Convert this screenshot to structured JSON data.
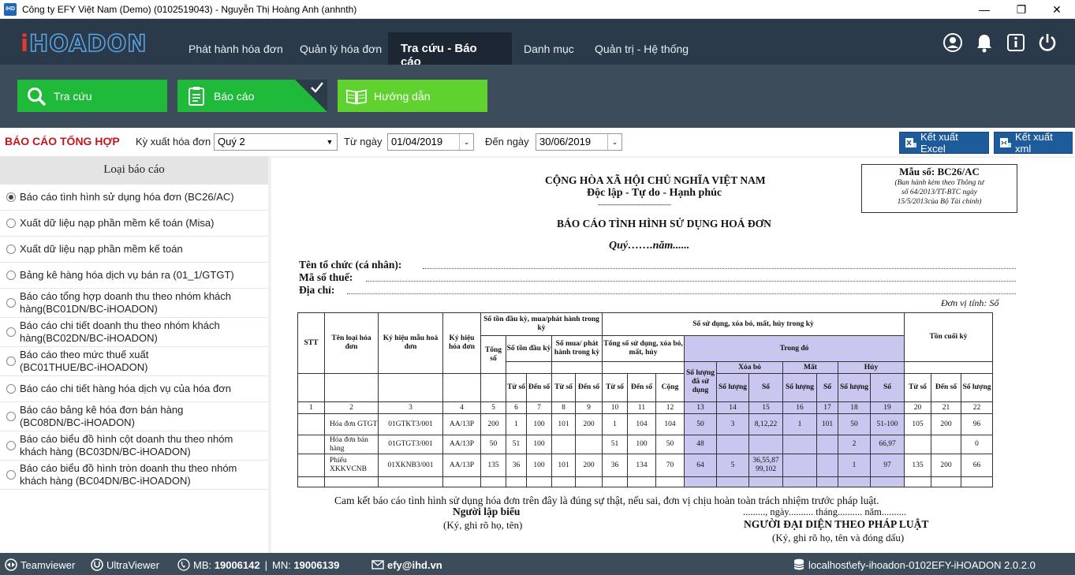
{
  "window": {
    "app_icon_text": "iHD",
    "title": "Công ty EFY Việt Nam (Demo) (0102519043) - Nguyễn Thị Hoàng Anh (anhnth)",
    "minimize": "—",
    "maximize": "❐",
    "close": "✕"
  },
  "brand": {
    "logo_i": "i",
    "logo_rest": "HOADON"
  },
  "nav": {
    "items": [
      "Phát hành hóa đơn",
      "Quản lý hóa đơn",
      "Tra cứu -  Báo cáo",
      "Danh mục",
      "Quản trị - Hệ thống"
    ],
    "active_index": 2,
    "icons": [
      "user-icon",
      "bell-icon",
      "info-icon",
      "power-icon"
    ]
  },
  "subnav": {
    "buttons": [
      {
        "label": "Tra cứu",
        "icon": "search-icon",
        "color": "#1fba3a"
      },
      {
        "label": "Báo cáo",
        "icon": "clipboard-icon",
        "color": "#1fba3a",
        "checked": true
      },
      {
        "label": "Hướng dẫn",
        "icon": "book-icon",
        "color": "#5fd22f"
      }
    ]
  },
  "filters": {
    "report_heading": "BÁO CÁO TỔNG HỢP",
    "period_label": "Kỳ xuất hóa đơn",
    "period_value": "Quý 2",
    "from_label": "Từ ngày",
    "from_value": "01/04/2019",
    "to_label": "Đến ngày",
    "to_value": "30/06/2019",
    "export_excel": "Kết xuất Excel",
    "export_xml": "Kết xuất xml"
  },
  "report_types": {
    "header": "Loại báo cáo",
    "selected_index": 0,
    "items": [
      {
        "line1": "Báo cáo tình hình sử dụng hóa đơn (BC26/AC)"
      },
      {
        "line1": "Xuất dữ liệu nạp phần mềm kế toán (Misa)"
      },
      {
        "line1": "Xuất dữ liệu nạp phần mềm kế toán"
      },
      {
        "line1": "Bảng kê hàng hóa dịch vụ bán ra (01_1/GTGT)"
      },
      {
        "line1": "Báo cáo tổng hợp doanh thu theo nhóm khách",
        "line2": "hàng(BC01DN/BC-iHOADON)"
      },
      {
        "line1": "Báo cáo chi tiết doanh thu theo nhóm khách",
        "line2": "hàng(BC02DN/BC-iHOADON)"
      },
      {
        "line1": "Báo cáo theo mức thuế xuất",
        "line2": "(BC01THUE/BC-iHOADON)"
      },
      {
        "line1": "Báo cáo chi tiết hàng hóa dịch vụ của hóa đơn"
      },
      {
        "line1": "Báo cáo bảng kê hóa đơn bán hàng",
        "line2": "(BC08DN/BC-iHOADON)"
      },
      {
        "line1": "Báo cáo biểu đồ hình cột doanh thu theo nhóm",
        "line2": "khách hàng (BC03DN/BC-iHOADON)"
      },
      {
        "line1": "Báo cáo biểu đồ hình tròn doanh thu theo nhóm",
        "line2": "khách hàng (BC04DN/BC-iHOADON)"
      }
    ]
  },
  "report": {
    "form_no": "Mẫu số: BC26/AC",
    "form_note1": "(Ban hành kèm theo Thông tư",
    "form_note2": "số 64/2013/TT-BTC  ngày",
    "form_note3": "15/5/2013của Bộ Tài chính)",
    "nation": "CỘNG HÒA XÃ HỘI CHỦ NGHĨA VIỆT NAM",
    "motto": "Độc lập - Tự do - Hạnh phúc",
    "motto_line": "-------------------------------",
    "title": "BÁO CÁO TÌNH HÌNH SỬ DỤNG HOÁ ĐƠN",
    "period": "Quý…….năm......",
    "org_label": "Tên tổ chức (cá nhân):",
    "tax_label": "Mã số thuế:",
    "addr_label": "Địa chỉ:",
    "unit": "Đơn vị tính: Số",
    "head": {
      "stt": "STT",
      "name": "Tên loại hóa đơn",
      "symbol": "Ký hiệu mẫu hoá đơn",
      "serial": "Ký hiệu hóa đơn",
      "opening_group": "Số tồn đầu kỳ, mua/phát hành trong kỳ",
      "total": "Tổng số",
      "opening": "Số tồn đầu kỳ",
      "bought": "Số mua/ phát hành trong kỳ",
      "used_group": "Số sử dụng, xóa bỏ, mất, hủy trong kỳ",
      "used_total": "Tổng số sử dụng, xóa bỏ, mất, hủy",
      "detail": "Trong đó",
      "used_qty": "Số lượng đã sử dụng",
      "deleted": "Xóa bỏ",
      "lost": "Mất",
      "cancelled": "Hủy",
      "closing": "Tồn cuối kỳ",
      "from_no": "Từ số",
      "to_no": "Đến số",
      "sum": "Cộng",
      "qty": "Số lượng",
      "num": "Số"
    },
    "col_numbers": [
      "1",
      "2",
      "3",
      "4",
      "5",
      "6",
      "7",
      "8",
      "9",
      "10",
      "11",
      "12",
      "13",
      "14",
      "15",
      "16",
      "17",
      "18",
      "19",
      "20",
      "21",
      "22"
    ],
    "rows": [
      [
        "",
        "Hóa đơn GTGT",
        "01GTKT3/001",
        "AA/13P",
        "200",
        "1",
        "100",
        "101",
        "200",
        "1",
        "104",
        "104",
        "50",
        "3",
        "8,12,22",
        "1",
        "101",
        "50",
        "51-100",
        "105",
        "200",
        "96"
      ],
      [
        "",
        "Hóa đơn bán hàng",
        "01GTGT3/001",
        "AA/13P",
        "50",
        "51",
        "100",
        "",
        "",
        "51",
        "100",
        "50",
        "48",
        "",
        "",
        "",
        "",
        "2",
        "66,97",
        "",
        "",
        "0"
      ],
      [
        "",
        "Phiếu XKKVCNB",
        "01XKNB3/001",
        "AA/13P",
        "135",
        "36",
        "100",
        "101",
        "200",
        "36",
        "134",
        "70",
        "64",
        "5",
        "36,55,87 99,102",
        "",
        "",
        "1",
        "97",
        "135",
        "200",
        "66"
      ],
      [
        "",
        "",
        "",
        "",
        "",
        "",
        "",
        "",
        "",
        "",
        "",
        "",
        "",
        "",
        "",
        "",
        "",
        "",
        "",
        "",
        "",
        ""
      ]
    ],
    "commitment": "Cam kết báo cáo tình hình sử dụng hóa đơn trên đây là đúng sự thật, nếu sai, đơn vị chịu hoàn toàn trách nhiệm trước pháp luật.",
    "preparer": "Người lập biểu",
    "preparer_note": "(Ký, ghi rõ họ, tên)",
    "date_line": "........., ngày.......... tháng.......... năm..........",
    "rep": "NGƯỜI ĐẠI DIỆN THEO PHÁP LUẬT",
    "rep_note": "(Ký, ghi rõ họ, tên và đóng dấu)"
  },
  "status": {
    "teamviewer": "Teamviewer",
    "ultraviewer": "UltraViewer",
    "mb_label": "MB:",
    "mb": "19006142",
    "mn_label": "MN:",
    "mn": "19006139",
    "email": "efy@ihd.vn",
    "server": "localhost\\efy-ihoadon-0102EFY-iHOADON 2.0.2.0"
  }
}
